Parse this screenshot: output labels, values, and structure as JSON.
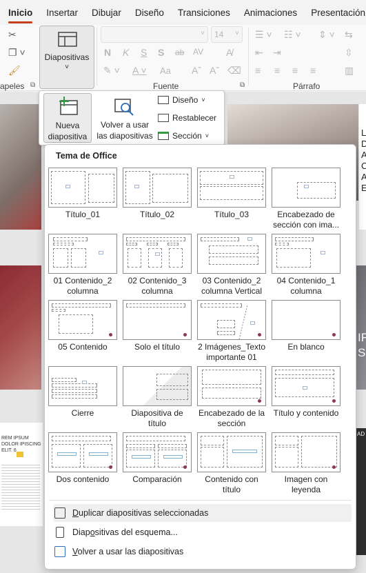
{
  "tabs": [
    "Inicio",
    "Insertar",
    "Dibujar",
    "Diseño",
    "Transiciones",
    "Animaciones",
    "Presentación co"
  ],
  "ribbon": {
    "clipboard_label": "apeles",
    "slides_button": "Diapositivas",
    "font_size": "14",
    "fuente_label": "Fuente",
    "parrafo_label": "Párrafo",
    "font_buttons": [
      "N",
      "K",
      "S",
      "S",
      "ab",
      "AV"
    ],
    "case_label": "Aa"
  },
  "slides_toolbar": {
    "new_slide": "Nueva diapositiva",
    "reuse": "Volver a usar las diapositivas",
    "layout": "Diseño",
    "reset": "Restablecer",
    "section": "Sección"
  },
  "panel": {
    "title": "Tema de Office",
    "layouts": [
      "Título_01",
      "Título_02",
      "Título_03",
      "Encabezado de sección con ima...",
      "01 Contenido_2 columna",
      "02 Contenido_3 columna",
      "03 Contenido_2 columna Vertical",
      "04 Contenido_1 columna",
      "05 Contenido",
      "Solo el título",
      "2 Imágenes_Texto importante 01",
      "En blanco",
      "Cierre",
      "Diapositiva de título",
      "Encabezado de la sección",
      "Título y contenido",
      "Dos contenido",
      "Comparación",
      "Contenido con título",
      "Imagen con leyenda"
    ],
    "menu": [
      {
        "pre": "",
        "u": "D",
        "post": "uplicar diapositivas seleccionadas"
      },
      {
        "pre": "Diap",
        "u": "o",
        "post": "sitivas del esquema..."
      },
      {
        "pre": "",
        "u": "V",
        "post": "olver a usar las diapositivas"
      }
    ]
  },
  "background": {
    "right_letters": [
      "L",
      "D",
      "A",
      "C",
      "A",
      "E"
    ],
    "right_big": [
      "IF",
      "S"
    ],
    "lorem_title": "REM IPSUM DOLOR IPISCING ELIT. 6",
    "right_small": "AD"
  },
  "colors": {
    "accent": "#c43e1c",
    "slide_red": "#8b2a33"
  }
}
